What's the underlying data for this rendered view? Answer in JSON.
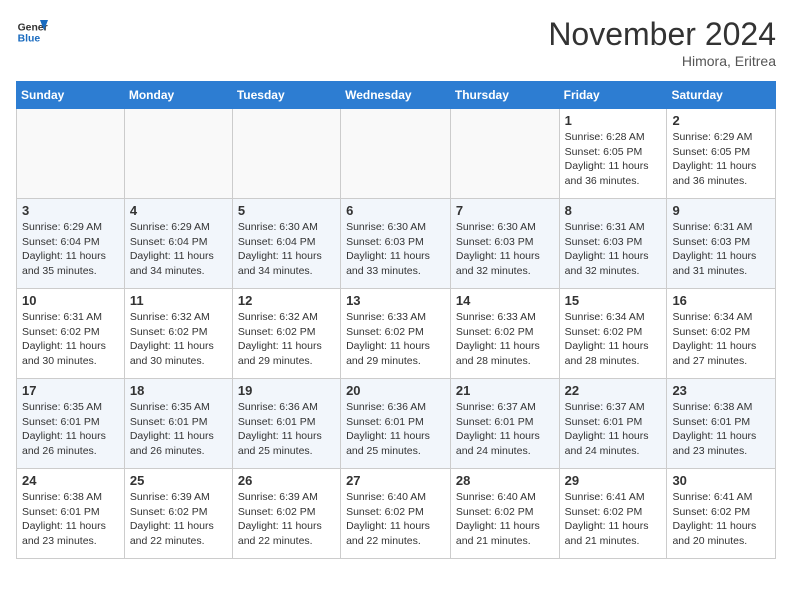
{
  "header": {
    "logo_line1": "General",
    "logo_line2": "Blue",
    "month": "November 2024",
    "location": "Himora, Eritrea"
  },
  "weekdays": [
    "Sunday",
    "Monday",
    "Tuesday",
    "Wednesday",
    "Thursday",
    "Friday",
    "Saturday"
  ],
  "weeks": [
    [
      {
        "day": "",
        "info": ""
      },
      {
        "day": "",
        "info": ""
      },
      {
        "day": "",
        "info": ""
      },
      {
        "day": "",
        "info": ""
      },
      {
        "day": "",
        "info": ""
      },
      {
        "day": "1",
        "info": "Sunrise: 6:28 AM\nSunset: 6:05 PM\nDaylight: 11 hours and 36 minutes."
      },
      {
        "day": "2",
        "info": "Sunrise: 6:29 AM\nSunset: 6:05 PM\nDaylight: 11 hours and 36 minutes."
      }
    ],
    [
      {
        "day": "3",
        "info": "Sunrise: 6:29 AM\nSunset: 6:04 PM\nDaylight: 11 hours and 35 minutes."
      },
      {
        "day": "4",
        "info": "Sunrise: 6:29 AM\nSunset: 6:04 PM\nDaylight: 11 hours and 34 minutes."
      },
      {
        "day": "5",
        "info": "Sunrise: 6:30 AM\nSunset: 6:04 PM\nDaylight: 11 hours and 34 minutes."
      },
      {
        "day": "6",
        "info": "Sunrise: 6:30 AM\nSunset: 6:03 PM\nDaylight: 11 hours and 33 minutes."
      },
      {
        "day": "7",
        "info": "Sunrise: 6:30 AM\nSunset: 6:03 PM\nDaylight: 11 hours and 32 minutes."
      },
      {
        "day": "8",
        "info": "Sunrise: 6:31 AM\nSunset: 6:03 PM\nDaylight: 11 hours and 32 minutes."
      },
      {
        "day": "9",
        "info": "Sunrise: 6:31 AM\nSunset: 6:03 PM\nDaylight: 11 hours and 31 minutes."
      }
    ],
    [
      {
        "day": "10",
        "info": "Sunrise: 6:31 AM\nSunset: 6:02 PM\nDaylight: 11 hours and 30 minutes."
      },
      {
        "day": "11",
        "info": "Sunrise: 6:32 AM\nSunset: 6:02 PM\nDaylight: 11 hours and 30 minutes."
      },
      {
        "day": "12",
        "info": "Sunrise: 6:32 AM\nSunset: 6:02 PM\nDaylight: 11 hours and 29 minutes."
      },
      {
        "day": "13",
        "info": "Sunrise: 6:33 AM\nSunset: 6:02 PM\nDaylight: 11 hours and 29 minutes."
      },
      {
        "day": "14",
        "info": "Sunrise: 6:33 AM\nSunset: 6:02 PM\nDaylight: 11 hours and 28 minutes."
      },
      {
        "day": "15",
        "info": "Sunrise: 6:34 AM\nSunset: 6:02 PM\nDaylight: 11 hours and 28 minutes."
      },
      {
        "day": "16",
        "info": "Sunrise: 6:34 AM\nSunset: 6:02 PM\nDaylight: 11 hours and 27 minutes."
      }
    ],
    [
      {
        "day": "17",
        "info": "Sunrise: 6:35 AM\nSunset: 6:01 PM\nDaylight: 11 hours and 26 minutes."
      },
      {
        "day": "18",
        "info": "Sunrise: 6:35 AM\nSunset: 6:01 PM\nDaylight: 11 hours and 26 minutes."
      },
      {
        "day": "19",
        "info": "Sunrise: 6:36 AM\nSunset: 6:01 PM\nDaylight: 11 hours and 25 minutes."
      },
      {
        "day": "20",
        "info": "Sunrise: 6:36 AM\nSunset: 6:01 PM\nDaylight: 11 hours and 25 minutes."
      },
      {
        "day": "21",
        "info": "Sunrise: 6:37 AM\nSunset: 6:01 PM\nDaylight: 11 hours and 24 minutes."
      },
      {
        "day": "22",
        "info": "Sunrise: 6:37 AM\nSunset: 6:01 PM\nDaylight: 11 hours and 24 minutes."
      },
      {
        "day": "23",
        "info": "Sunrise: 6:38 AM\nSunset: 6:01 PM\nDaylight: 11 hours and 23 minutes."
      }
    ],
    [
      {
        "day": "24",
        "info": "Sunrise: 6:38 AM\nSunset: 6:01 PM\nDaylight: 11 hours and 23 minutes."
      },
      {
        "day": "25",
        "info": "Sunrise: 6:39 AM\nSunset: 6:02 PM\nDaylight: 11 hours and 22 minutes."
      },
      {
        "day": "26",
        "info": "Sunrise: 6:39 AM\nSunset: 6:02 PM\nDaylight: 11 hours and 22 minutes."
      },
      {
        "day": "27",
        "info": "Sunrise: 6:40 AM\nSunset: 6:02 PM\nDaylight: 11 hours and 22 minutes."
      },
      {
        "day": "28",
        "info": "Sunrise: 6:40 AM\nSunset: 6:02 PM\nDaylight: 11 hours and 21 minutes."
      },
      {
        "day": "29",
        "info": "Sunrise: 6:41 AM\nSunset: 6:02 PM\nDaylight: 11 hours and 21 minutes."
      },
      {
        "day": "30",
        "info": "Sunrise: 6:41 AM\nSunset: 6:02 PM\nDaylight: 11 hours and 20 minutes."
      }
    ]
  ]
}
